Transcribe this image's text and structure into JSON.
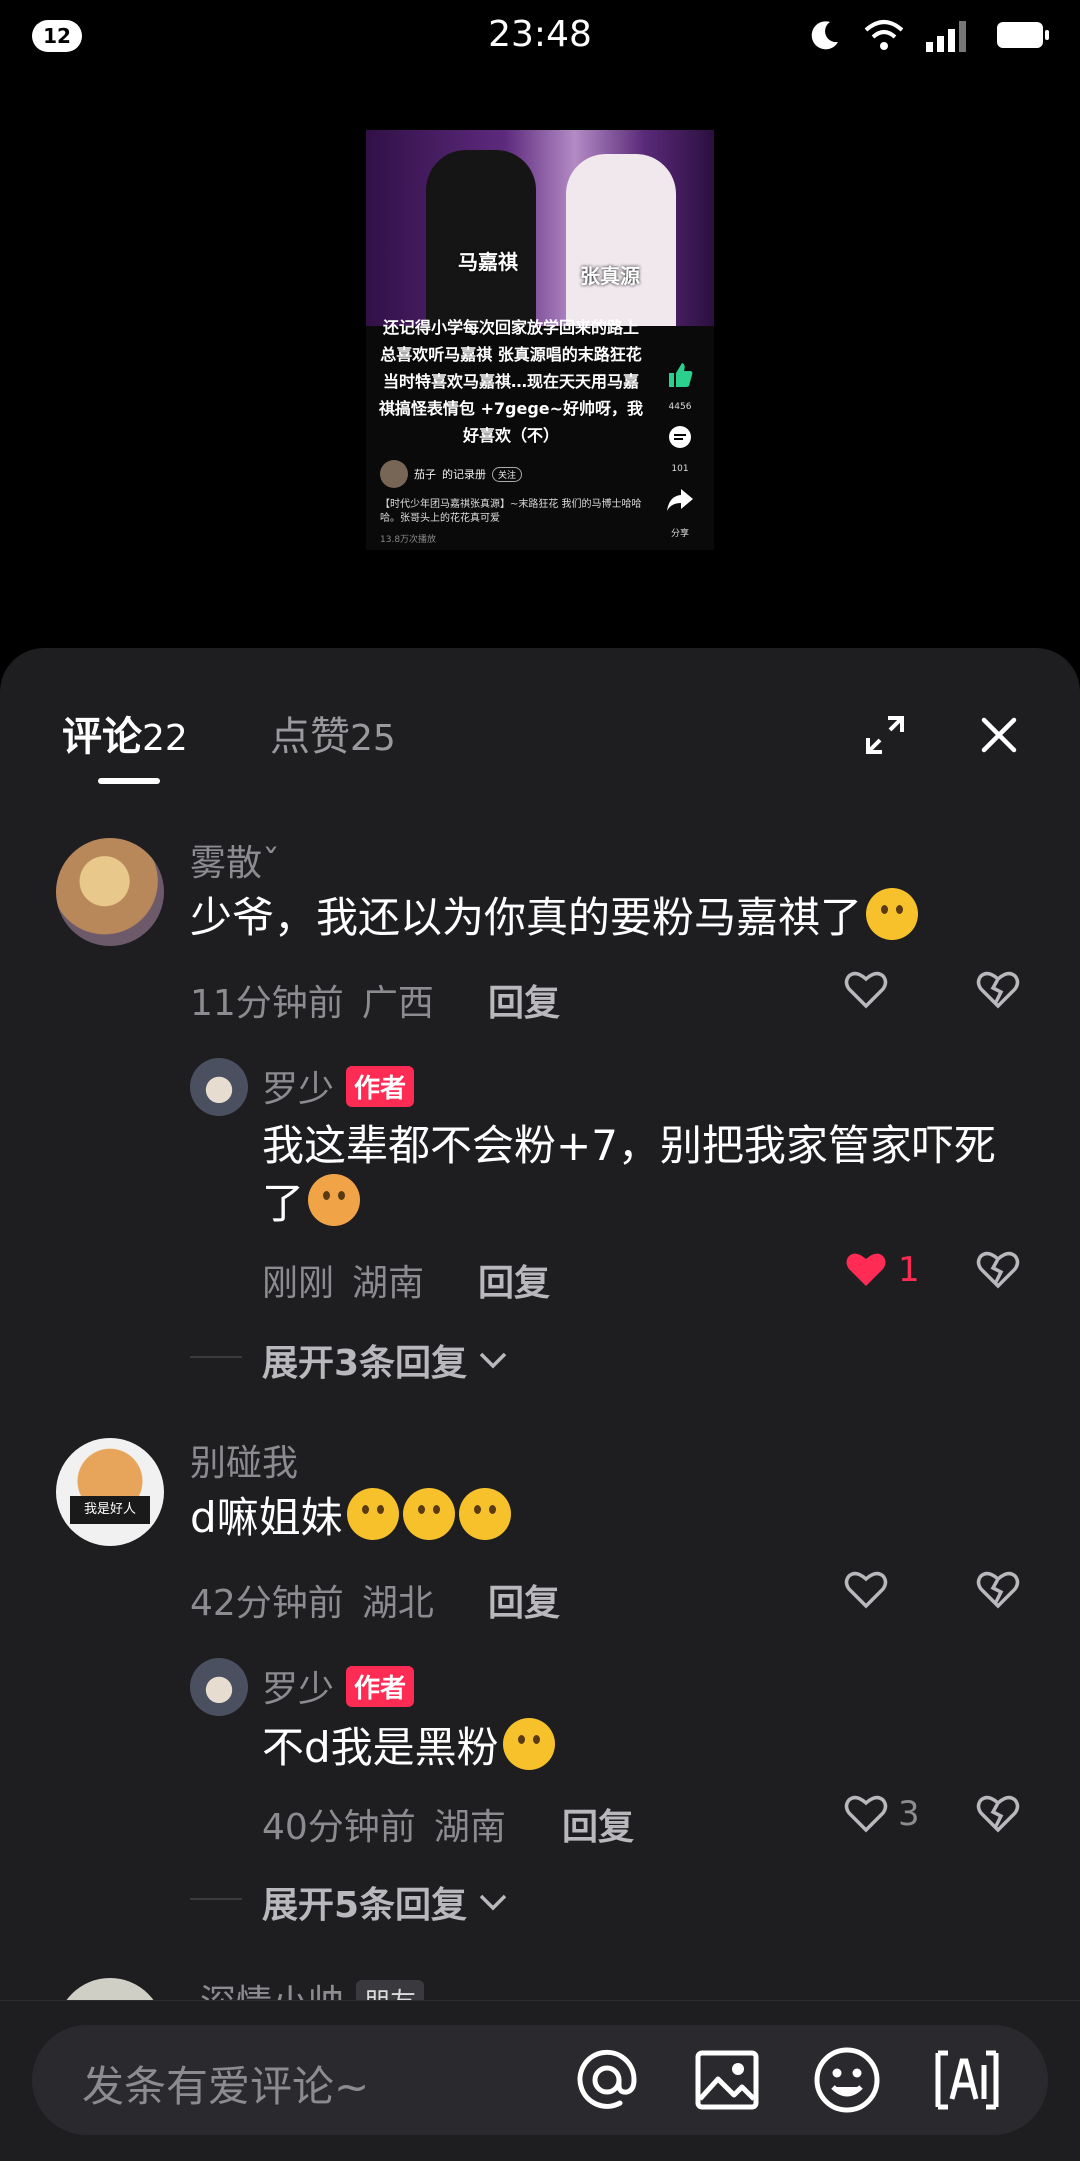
{
  "status_bar": {
    "notification_count": "12",
    "time": "23:48"
  },
  "video": {
    "name_left": "马嘉祺",
    "name_right": "张真源",
    "caption": "还记得小学每次回家放学回来的路上总喜欢听马嘉祺 张真源唱的末路狂花当时特喜欢马嘉祺…现在天天用马嘉祺搞怪表情包 +7gege~好帅呀，我好喜欢（不）",
    "like_count": "4456",
    "comment_count": "101",
    "share_label": "分享",
    "author": "茄子",
    "author_suffix": "的记录册",
    "follow_label": "关注",
    "description": "【时代少年团马嘉祺张真源】~末路狂花 我们的马博士哈哈哈。张哥头上的花花真可爱",
    "views": "13.8万次播放"
  },
  "sheet": {
    "tab_comments_label": "评论",
    "tab_comments_count": "22",
    "tab_likes_label": "点赞",
    "tab_likes_count": "25"
  },
  "comments": [
    {
      "username": "雾散ˇ",
      "text": "少爷，我还以为你真的要粉马嘉祺了",
      "time": "11分钟前",
      "location": "广西",
      "reply_label": "回复"
    },
    {
      "username": "罗少",
      "badge": "作者",
      "text": "我这辈都不会粉+7，别把我家管家吓死了",
      "time": "刚刚",
      "location": "湖南",
      "reply_label": "回复",
      "like_count": "1",
      "expand_label": "展开3条回复"
    },
    {
      "username": "别碰我",
      "text": "d嘛姐妹",
      "time": "42分钟前",
      "location": "湖北",
      "reply_label": "回复",
      "avatar_text": "我是好人"
    },
    {
      "username": "罗少",
      "badge": "作者",
      "text": "不d我是黑粉",
      "time": "40分钟前",
      "location": "湖南",
      "reply_label": "回复",
      "like_count": "3",
      "expand_label": "展开5条回复"
    },
    {
      "username": "深情小帅",
      "badge": "朋友"
    }
  ],
  "input": {
    "placeholder": "发条有爱评论~"
  },
  "colors": {
    "sheet_bg": "#1e1e21",
    "accent_red": "#fe2c55",
    "muted_text": "#8b8b90"
  }
}
